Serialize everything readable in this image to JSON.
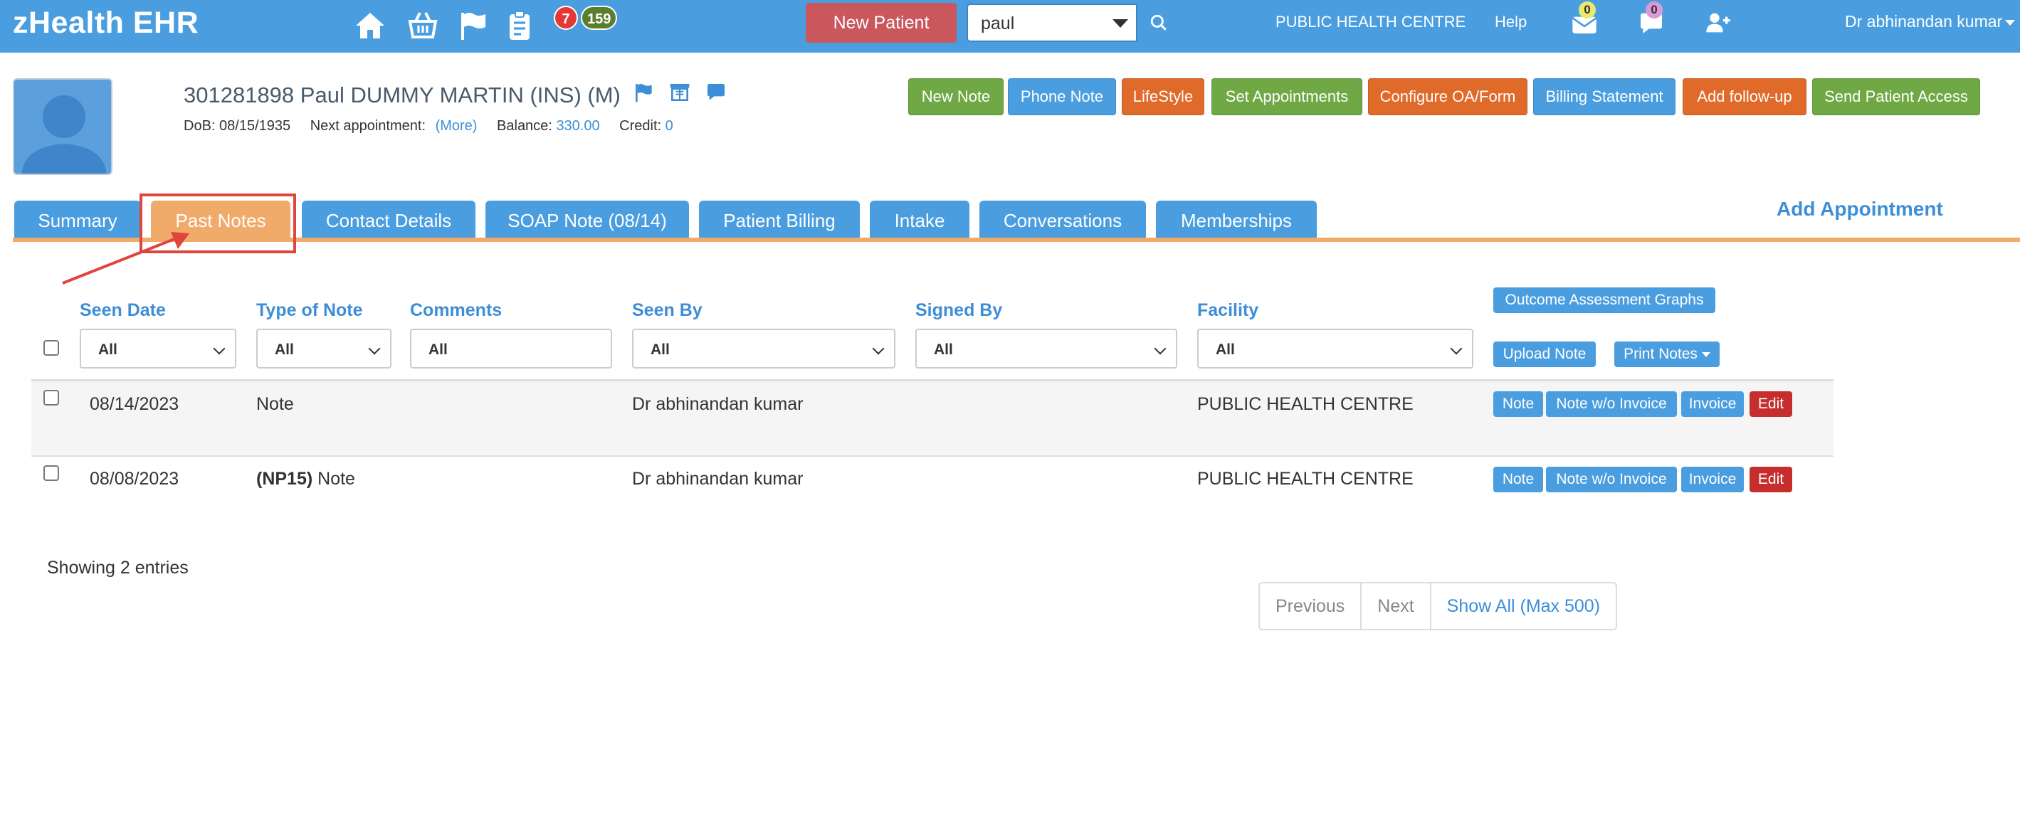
{
  "app": {
    "brand": "zHealth EHR"
  },
  "topbar": {
    "badges": {
      "alerts": "7",
      "tasks": "159"
    },
    "new_patient_label": "New Patient",
    "search": {
      "value": "paul"
    },
    "facility_label": "PUBLIC HEALTH CENTRE",
    "help_label": "Help",
    "mail_count": "0",
    "chat_count": "0",
    "user_label": "Dr abhinandan kumar",
    "icons": [
      "home-icon",
      "basket-icon",
      "flag-icon",
      "clipboard-icon",
      "mail-icon",
      "chat-icon",
      "add-user-icon"
    ]
  },
  "patient": {
    "name": "301281898 Paul DUMMY MARTIN  (INS) (M)",
    "dob_label": "DoB: 08/15/1935",
    "next_appt_label": "Next appointment:",
    "next_appt_link": "(More)",
    "balance_label": "Balance:",
    "balance_value": "330.00",
    "credit_label": "Credit:",
    "credit_value": "0"
  },
  "actions": [
    {
      "label": "New Note",
      "color": "#6fa844"
    },
    {
      "label": "Phone Note",
      "color": "#4a9ee0"
    },
    {
      "label": "LifeStyle",
      "color": "#e06a2a"
    },
    {
      "label": "Set Appointments",
      "color": "#6fa844"
    },
    {
      "label": "Configure OA/Form",
      "color": "#e06a2a"
    },
    {
      "label": "Billing Statement",
      "color": "#4a9ee0"
    },
    {
      "label": "Add follow-up",
      "color": "#e06a2a"
    },
    {
      "label": "Send Patient Access",
      "color": "#6fa844"
    }
  ],
  "tabs": [
    {
      "label": "Summary"
    },
    {
      "label": "Past Notes",
      "active": true
    },
    {
      "label": "Contact Details"
    },
    {
      "label": "SOAP Note (08/14)"
    },
    {
      "label": "Patient Billing"
    },
    {
      "label": "Intake"
    },
    {
      "label": "Conversations"
    },
    {
      "label": "Memberships"
    }
  ],
  "add_appointment_label": "Add Appointment",
  "table": {
    "columns": [
      "Seen Date",
      "Type of Note",
      "Comments",
      "Seen By",
      "Signed By",
      "Facility"
    ],
    "filters": [
      "All",
      "All",
      "All",
      "All",
      "All",
      "All"
    ],
    "buttons": {
      "outcome_graphs": "Outcome Assessment Graphs",
      "upload_note": "Upload Note",
      "print_notes": "Print Notes"
    },
    "rows": [
      {
        "seen_date": "08/14/2023",
        "note_prefix": "",
        "type": "Note",
        "comments": "",
        "seen_by": "Dr abhinandan kumar",
        "signed_by": "",
        "facility": "PUBLIC HEALTH CENTRE",
        "actions": [
          "Note",
          "Note w/o Invoice",
          "Invoice",
          "Edit"
        ]
      },
      {
        "seen_date": "08/08/2023",
        "note_prefix": "(NP15)",
        "type": "Note",
        "comments": "",
        "seen_by": "Dr abhinandan kumar",
        "signed_by": "",
        "facility": "PUBLIC HEALTH CENTRE",
        "actions": [
          "Note",
          "Note w/o Invoice",
          "Invoice",
          "Edit"
        ]
      }
    ]
  },
  "footer": {
    "showing": "Showing 2 entries",
    "pager": {
      "previous": "Previous",
      "next": "Next",
      "show_all": "Show All (Max 500)"
    }
  }
}
